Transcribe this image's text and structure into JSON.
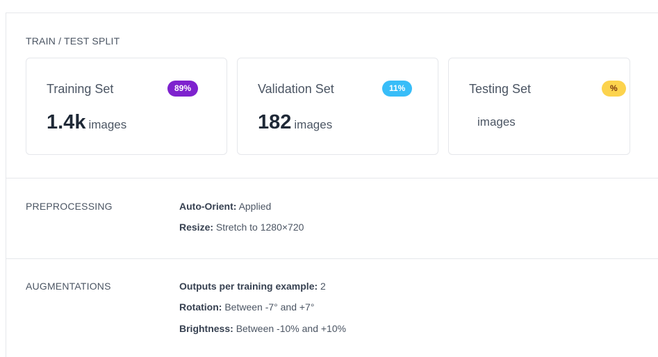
{
  "split": {
    "title": "TRAIN / TEST SPLIT",
    "cards": [
      {
        "title": "Training Set",
        "badge": "89%",
        "value": "1.4k",
        "unit": "images",
        "badge_color": "#7e22ce"
      },
      {
        "title": "Validation Set",
        "badge": "11%",
        "value": "182",
        "unit": "images",
        "badge_color": "#38bdf8"
      },
      {
        "title": "Testing Set",
        "badge": "%",
        "value": "",
        "unit": "images",
        "badge_color": "#fcd34d"
      }
    ]
  },
  "preprocessing": {
    "title": "PREPROCESSING",
    "items": [
      {
        "key": "Auto-Orient:",
        "value": "Applied"
      },
      {
        "key": "Resize:",
        "value": "Stretch to 1280×720"
      }
    ]
  },
  "augmentations": {
    "title": "AUGMENTATIONS",
    "items": [
      {
        "key": "Outputs per training example:",
        "value": "2"
      },
      {
        "key": "Rotation:",
        "value": "Between -7° and +7°"
      },
      {
        "key": "Brightness:",
        "value": "Between -10% and +10%"
      }
    ]
  }
}
